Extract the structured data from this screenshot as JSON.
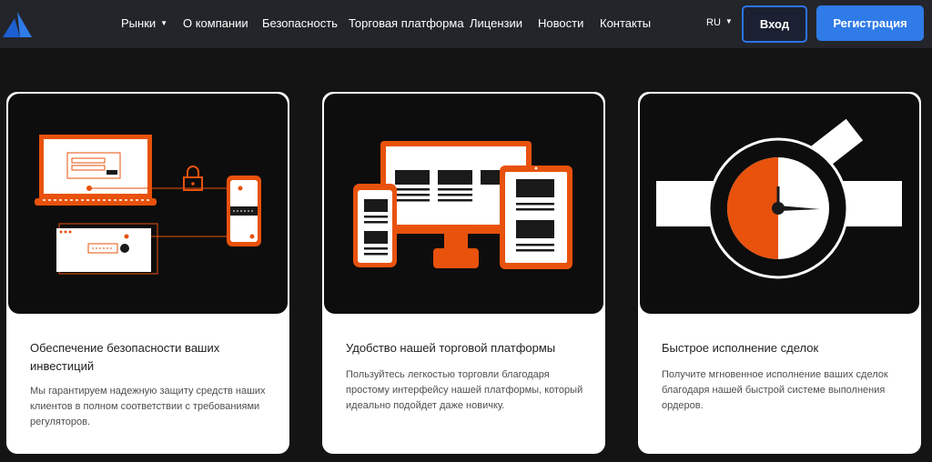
{
  "header": {
    "logo_icon": "brand-triangle-logo-icon",
    "nav": [
      {
        "label": "Рынки",
        "has_dropdown": true
      },
      {
        "label": "О компании"
      },
      {
        "label": "Безопасность"
      },
      {
        "label": "Торговая платформа"
      },
      {
        "label": "Лицензии"
      },
      {
        "label": "Новости"
      },
      {
        "label": "Контакты"
      }
    ],
    "language": "RU",
    "login_label": "Вход",
    "register_label": "Регистрация"
  },
  "colors": {
    "accent": "#e8520c",
    "primary_blue": "#2f7be8",
    "header_bg": "#23252a",
    "page_bg": "#141414"
  },
  "cards": [
    {
      "illustration": "secure-devices-illustration",
      "title": "Обеспечение безопасности ваших инвестиций",
      "text": "Мы гарантируем надежную защиту средств наших клиентов в полном соответствии с требованиями регуляторов."
    },
    {
      "illustration": "multi-device-platform-illustration",
      "title": "Удобство нашей торговой платформы",
      "text": "Пользуйтесь легкостью торговли благодаря простому интерфейсу нашей платформы, который идеально подойдет даже новичку."
    },
    {
      "illustration": "stopwatch-speed-illustration",
      "title": "Быстрое исполнение сделок",
      "text": "Получите мгновенное исполнение ваших сделок благодаря нашей быстрой системе выполнения ордеров."
    }
  ]
}
